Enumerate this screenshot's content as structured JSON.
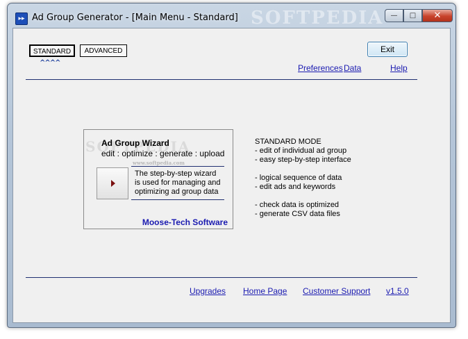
{
  "window": {
    "title": "Ad Group Generator - [Main Menu - Standard]",
    "watermark": "SOFTPEDIA",
    "controls": {
      "minimize": "—",
      "maximize": "□",
      "close": "✕"
    }
  },
  "tabs": [
    {
      "label": "STANDARD",
      "selected": true
    },
    {
      "label": "ADVANCED",
      "selected": false
    }
  ],
  "selected_marker": "^^^^",
  "exit_label": "Exit",
  "top_links": {
    "preferences": "Preferences",
    "data": "Data",
    "help": "Help"
  },
  "wizard": {
    "title": "Ad Group Wizard",
    "subtitle": "edit : optimize : generate : upload",
    "description": [
      "The step-by-step wizard",
      "is used for managing and",
      "optimizing ad group data"
    ],
    "brand": "Moose-Tech Software",
    "watermark": "www.softpedia.com"
  },
  "mode_info": {
    "heading": "STANDARD MODE",
    "lines": [
      "- edit of individual ad group",
      "- easy step-by-step interface",
      "- logical sequence of data",
      "- edit ads and keywords",
      "- check data is optimized",
      "- generate CSV data files"
    ]
  },
  "footer_links": {
    "upgrades": "Upgrades",
    "home": "Home Page",
    "support": "Customer Support",
    "version": "v1.5.0"
  },
  "colors": {
    "link": "#1a1ab0",
    "accent_line": "#1f2f70",
    "client_bg": "#f0f0f0"
  }
}
